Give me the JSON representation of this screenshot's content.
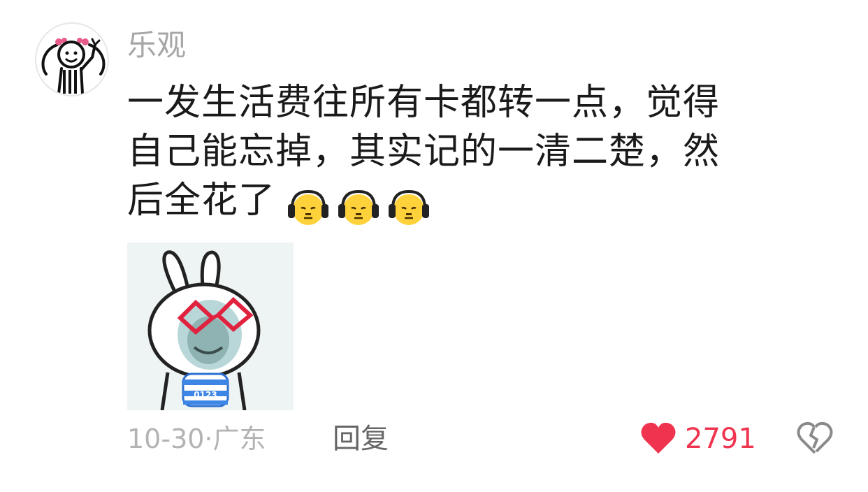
{
  "comment": {
    "username": "乐观",
    "text_lines": [
      "一发生活费往所有卡都转一点，觉得",
      "自己能忘掉，其实记的一清二楚，然",
      "后全花了"
    ],
    "emojis": [
      "headphone-emoji",
      "headphone-emoji",
      "headphone-emoji"
    ],
    "sticker": "rabbit-glasses-sticker",
    "sticker_jersey_text": "0123",
    "date": "10-30",
    "separator": "·",
    "location": "广东",
    "reply_label": "回复",
    "like_count": "2791",
    "colors": {
      "like": "#f0344f",
      "username": "#a6a6a6",
      "text": "#1a1a1a",
      "meta": "#b3b3b3"
    }
  }
}
